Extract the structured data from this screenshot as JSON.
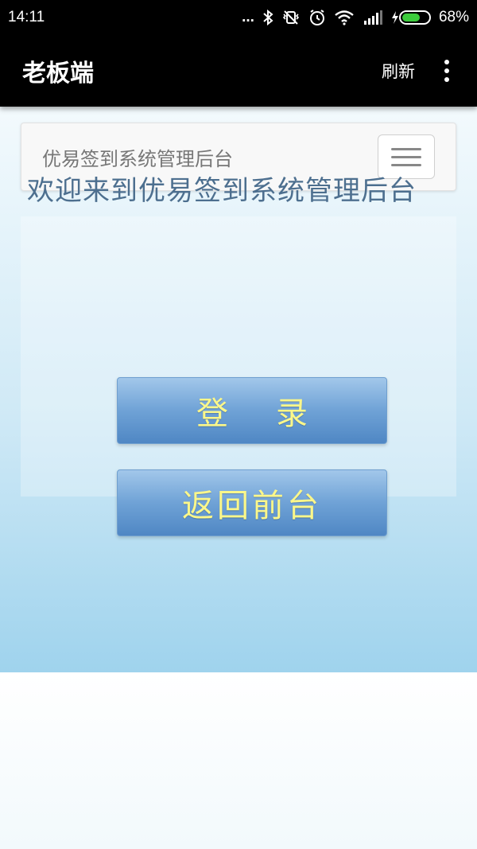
{
  "status_bar": {
    "time": "14:11",
    "dots": "...",
    "battery_percent": "68%",
    "battery_level": 0.68,
    "icons": [
      "bluetooth-icon",
      "vibrate-icon",
      "alarm-icon",
      "wifi-icon",
      "signal-icon",
      "charging-icon",
      "battery-icon"
    ]
  },
  "app_bar": {
    "title": "老板端",
    "refresh_label": "刷新",
    "more_icon": "more-vert-icon"
  },
  "navbar": {
    "brand": "优易签到系统管理后台",
    "toggle_icon": "hamburger-icon"
  },
  "main": {
    "welcome": "欢迎来到优易签到系统管理后台",
    "login_label": "登录",
    "back_label": "返回前台"
  },
  "colors": {
    "button_text": "#fbf78a",
    "button_bg": "#6fa2d6",
    "welcome_text": "#4d6f8f",
    "battery": "#3ccc3c"
  }
}
